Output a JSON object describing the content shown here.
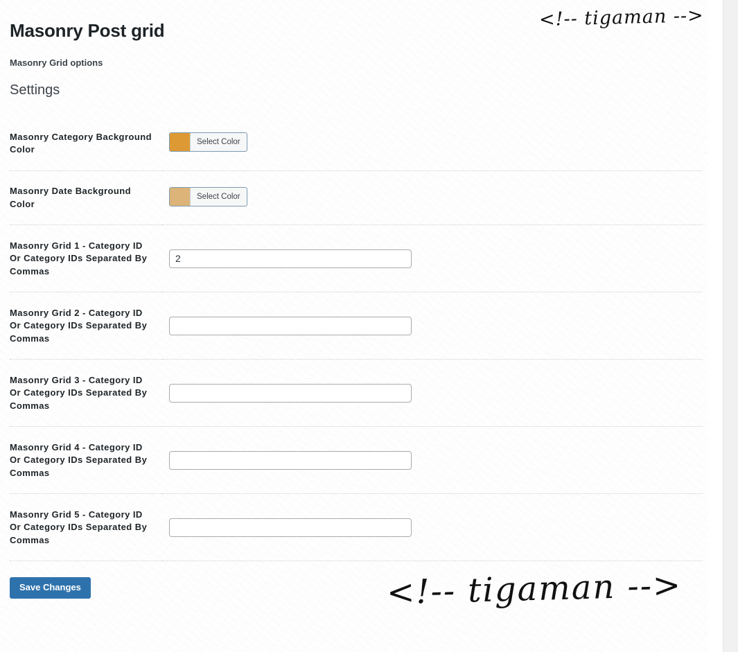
{
  "page": {
    "title": "Masonry Post grid",
    "subtitle": "Masonry Grid options",
    "settings_heading": "Settings"
  },
  "watermark": {
    "text": "<!-- tigaman -->"
  },
  "colors": {
    "category_background": "#dd9933",
    "date_background": "#dcb378",
    "button_primary": "#2e72ad",
    "picker_border": "#7c9bb2",
    "input_border": "#a7aaad",
    "separator": "#cfcfcf"
  },
  "settings": {
    "color_fields": [
      {
        "label": "Masonry Category Background Color",
        "button_label": "Select Color",
        "value": "#dd9933"
      },
      {
        "label": "Masonry Date Background Color",
        "button_label": "Select Color",
        "value": "#dcb378"
      }
    ],
    "text_fields": [
      {
        "label": "Masonry Grid 1 - Category ID Or Category IDs Separated By Commas",
        "value": "2",
        "placeholder": ""
      },
      {
        "label": "Masonry Grid 2 - Category ID Or Category IDs Separated By Commas",
        "value": "",
        "placeholder": ""
      },
      {
        "label": "Masonry Grid 3 - Category ID Or Category IDs Separated By Commas",
        "value": "",
        "placeholder": ""
      },
      {
        "label": "Masonry Grid 4 - Category ID Or Category IDs Separated By Commas",
        "value": "",
        "placeholder": ""
      },
      {
        "label": "Masonry Grid 5 - Category ID Or Category IDs Separated By Commas",
        "value": "",
        "placeholder": ""
      }
    ]
  },
  "submit": {
    "save_label": "Save Changes"
  }
}
